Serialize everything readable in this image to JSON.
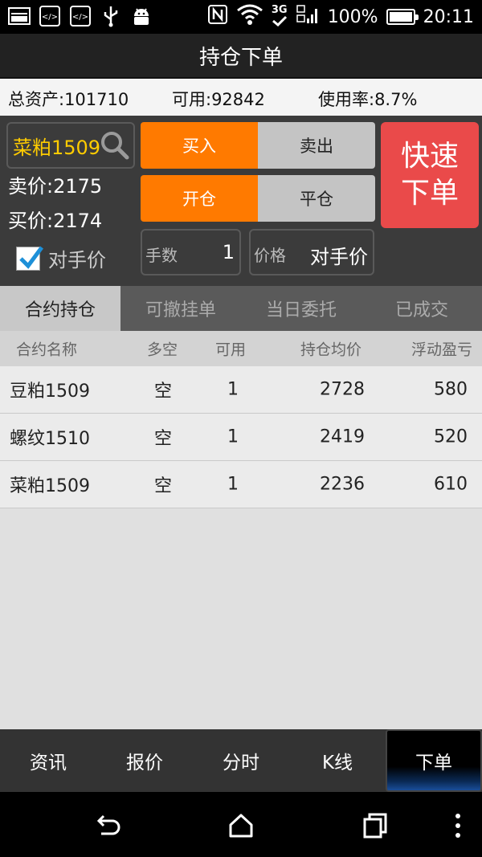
{
  "status_bar": {
    "network": "3G",
    "battery": "100%",
    "battery_level": 1.0,
    "time": "20:11"
  },
  "title": "持仓下单",
  "account": {
    "total_assets": "总资产:101710",
    "available": "可用:92842",
    "usage_rate": "使用率:8.7%"
  },
  "order": {
    "contract": "菜粕1509",
    "ask": "卖价:2175",
    "bid": "买价:2174",
    "counterparty_checkbox": {
      "label": "对手价",
      "checked": true
    },
    "direction": {
      "buy": "买入",
      "sell": "卖出",
      "selected": "买入"
    },
    "offset": {
      "open": "开仓",
      "close": "平仓",
      "selected": "开仓"
    },
    "quick_order": [
      "快速",
      "下单"
    ],
    "lots_label": "手数",
    "lots_value": "1",
    "price_label": "价格",
    "price_value": "对手价"
  },
  "tabs": [
    {
      "label": "合约持仓",
      "active": true
    },
    {
      "label": "可撤挂单",
      "active": false
    },
    {
      "label": "当日委托",
      "active": false
    },
    {
      "label": "已成交",
      "active": false
    }
  ],
  "table": {
    "columns": [
      "合约名称",
      "多空",
      "可用",
      "持仓均价",
      "浮动盈亏"
    ],
    "rows": [
      [
        "豆粕1509",
        "空",
        "1",
        "2728",
        "580"
      ],
      [
        "螺纹1510",
        "空",
        "1",
        "2419",
        "520"
      ],
      [
        "菜粕1509",
        "空",
        "1",
        "2236",
        "610"
      ]
    ]
  },
  "bottom_nav": [
    {
      "label": "资讯",
      "active": false
    },
    {
      "label": "报价",
      "active": false
    },
    {
      "label": "分时",
      "active": false
    },
    {
      "label": "K线",
      "active": false
    },
    {
      "label": "下单",
      "active": true
    }
  ],
  "colors": {
    "accent": "#ff7a00",
    "quick_order": "#ea4a4a",
    "contract_text": "#ffcc00",
    "check": "#1e90d8"
  }
}
